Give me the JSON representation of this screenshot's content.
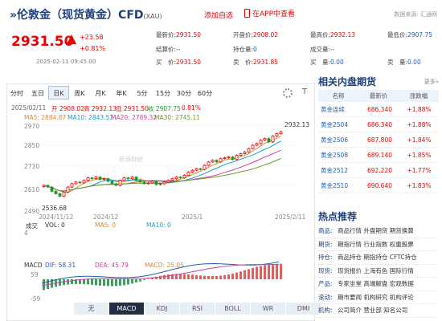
{
  "header": {
    "title": "伦敦金（现货黄金）CFD",
    "code": "(XAU)",
    "add_watchlist": "添加自选",
    "open_app": "在APP中查看",
    "source": "数据来源: 汇通网"
  },
  "quote": {
    "price": "2931.50",
    "change": "+23.58",
    "change_pct": "+0.81%",
    "time": "2025-02-11 09:45:00",
    "fields": [
      {
        "label": "最新价:",
        "value": "2931.50"
      },
      {
        "label": "开盘价:",
        "value": "2908.02"
      },
      {
        "label": "最高价:",
        "value": "2932.13"
      },
      {
        "label": "最低价:",
        "value": "2907.75"
      },
      {
        "label": "结算价:",
        "value": "--"
      },
      {
        "label": "持仓量:",
        "value": "0"
      },
      {
        "label": "成交量:",
        "value": "--"
      },
      {
        "label": "",
        "value": ""
      },
      {
        "label": "买　价:",
        "value": "2931.50"
      },
      {
        "label": "卖　价:",
        "value": "2931.85"
      },
      {
        "label": "买　量:",
        "value": "0.00"
      },
      {
        "label": "卖　量:",
        "value": "0.00"
      }
    ]
  },
  "chart": {
    "tabs": [
      "分时",
      "五日",
      "日K",
      "周K",
      "月K",
      "年K",
      "5分",
      "15分",
      "30分",
      "60分"
    ],
    "active_tab": "日K",
    "info_line": "2025/02/11",
    "info_open": "开 2908.02",
    "info_high": "高 2932.13",
    "info_low": "低 2931.50",
    "info_close": "收 2907.75",
    "info_pct": "0.81%",
    "ma": [
      {
        "label": "MA5: 2884.87",
        "color": "#e08a2a"
      },
      {
        "label": "MA10: 2843.51",
        "color": "#1d9ad6"
      },
      {
        "label": "MA20: 2789.32",
        "color": "#d040a0"
      },
      {
        "label": "MA30: 2745.11",
        "color": "#6a9a20"
      }
    ],
    "y_ticks": [
      "2970",
      "2850",
      "2730",
      "2610",
      "2490"
    ],
    "x_ticks": [
      "2024/11/12",
      "2024/12",
      "2025/1",
      "2025/2/11"
    ],
    "max_label": "2932.13",
    "min_label": "2536.68",
    "watermark": "新浪财经",
    "vol_line": {
      "name": "成交",
      "vol": "VOL: 0",
      "ma5": "MA5: 0",
      "ma10": "MA10: 0",
      "scale": "4"
    },
    "macd_line": {
      "name": "MACD",
      "dif": "DIF: 58.31",
      "dea": "DEA: 45.79",
      "macd": "MACD: 25.05"
    },
    "macd_ticks": [
      "59",
      "-59"
    ],
    "bottom_tabs": [
      "无",
      "MACD",
      "KDJ",
      "RSI",
      "BOLL",
      "WR",
      "DMI"
    ],
    "active_bottom": "MACD"
  },
  "chart_data": {
    "type": "candlestick",
    "x_range": [
      "2024/11/12",
      "2025/2/11"
    ],
    "ylim": [
      2490,
      2970
    ],
    "close": [
      2610,
      2600,
      2575,
      2560,
      2545,
      2570,
      2600,
      2620,
      2630,
      2625,
      2640,
      2655,
      2650,
      2660,
      2645,
      2650,
      2635,
      2620,
      2610,
      2640,
      2655,
      2650,
      2660,
      2640,
      2630,
      2620,
      2625,
      2635,
      2615,
      2620,
      2630,
      2640,
      2650,
      2660,
      2655,
      2670,
      2690,
      2700,
      2710,
      2705,
      2730,
      2750,
      2760,
      2750,
      2770,
      2775,
      2780,
      2765,
      2790,
      2800,
      2810,
      2830,
      2850,
      2860,
      2880,
      2890,
      2870,
      2905,
      2920,
      2931
    ]
  },
  "sidebar": {
    "title": "相关内盘期货",
    "more": "更多»",
    "cols": [
      "名称",
      "最新价",
      "涨跌幅"
    ],
    "rows": [
      {
        "n": "黄金连续",
        "p": "686.340",
        "c": "+1.88%"
      },
      {
        "n": "黄金2504",
        "p": "686.340",
        "c": "+1.88%"
      },
      {
        "n": "黄金2506",
        "p": "687.800",
        "c": "+1.84%"
      },
      {
        "n": "黄金2508",
        "p": "689.140",
        "c": "+1.85%"
      },
      {
        "n": "黄金2512",
        "p": "692.220",
        "c": "+1.77%"
      },
      {
        "n": "黄金2510",
        "p": "690.640",
        "c": "+1.83%"
      }
    ],
    "hot_title": "热点推荐",
    "hot": [
      {
        "k": "商品:",
        "v": "商品行情 外盘期货 期货换算"
      },
      {
        "k": "期货:",
        "v": "期指行情 行业指数 权重股票"
      },
      {
        "k": "持仓:",
        "v": "商品持仓 期指持仓 CFTC持仓"
      },
      {
        "k": "现货:",
        "v": "现货报价 上海有色 国际行情"
      },
      {
        "k": "产品:",
        "v": "专家坐堂 高端解盘 宏观数据"
      },
      {
        "k": "滚动:",
        "v": "期市要闻 机构研究 机构评论"
      },
      {
        "k": "机构:",
        "v": "公司简介 营业部 知名公司"
      }
    ]
  }
}
